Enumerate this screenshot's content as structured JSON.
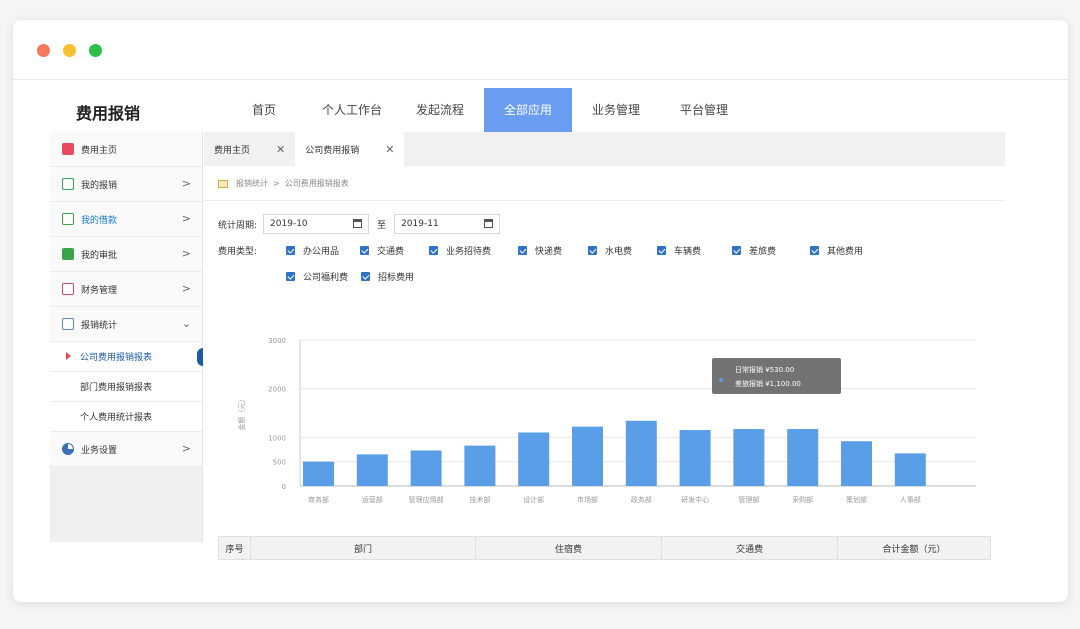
{
  "app": {
    "title": "费用报销"
  },
  "topnav": [
    {
      "label": "首页"
    },
    {
      "label": "个人工作台"
    },
    {
      "label": "发起流程"
    },
    {
      "label": "全部应用",
      "active": true
    },
    {
      "label": "业务管理"
    },
    {
      "label": "平台管理"
    }
  ],
  "sidebar": {
    "items": [
      {
        "label": "费用主页",
        "icon": "home-icon"
      },
      {
        "label": "我的报销",
        "icon": "receipt-icon"
      },
      {
        "label": "我的借款",
        "icon": "loan-icon"
      },
      {
        "label": "我的审批",
        "icon": "approval-icon"
      },
      {
        "label": "财务管理",
        "icon": "finance-icon"
      },
      {
        "label": "报销统计",
        "icon": "stats-icon"
      },
      {
        "label": "业务设置",
        "icon": "settings-icon"
      }
    ],
    "subitems": [
      {
        "label": "公司费用报销报表",
        "active": true
      },
      {
        "label": "部门费用报销报表"
      },
      {
        "label": "个人费用统计报表"
      }
    ]
  },
  "tabs": [
    {
      "label": "费用主页",
      "close": "✕"
    },
    {
      "label": "公司费用报销",
      "close": "✕",
      "active": true
    }
  ],
  "breadcrumb": {
    "parent": "报销统计",
    "separator": ">",
    "current": "公司费用报销报表"
  },
  "filters": {
    "period_label": "统计周期:",
    "start": "2019-10",
    "to_label": "至",
    "end": "2019-11",
    "type_label": "费用类型:",
    "types": [
      "办公用品",
      "交通费",
      "业务招待费",
      "快递费",
      "水电费",
      "车辆费",
      "差旅费",
      "其他费用",
      "公司福利费",
      "招标费用"
    ]
  },
  "chart_data": {
    "type": "bar",
    "ylabel": "金额（元）",
    "ylim": [
      0,
      3000
    ],
    "yticks": [
      0,
      500,
      1000,
      2000,
      3000
    ],
    "categories": [
      "商务部",
      "运营部",
      "管理应用部",
      "技术部",
      "设计部",
      "市场部",
      "政务部",
      "研发中心",
      "管理部",
      "采购部",
      "策划部",
      "人事部"
    ],
    "values": [
      500,
      650,
      730,
      830,
      1100,
      1220,
      1340,
      1150,
      1170,
      1170,
      920,
      670
    ],
    "color": "#5a9ee8",
    "grid": true,
    "tooltip": {
      "line1": "日常报销 ¥530.00",
      "line2": "差旅报销 ¥1,100.00"
    }
  },
  "table": {
    "headers": [
      "序号",
      "部门",
      "住宿费",
      "交通费",
      "合计金额（元）"
    ]
  }
}
